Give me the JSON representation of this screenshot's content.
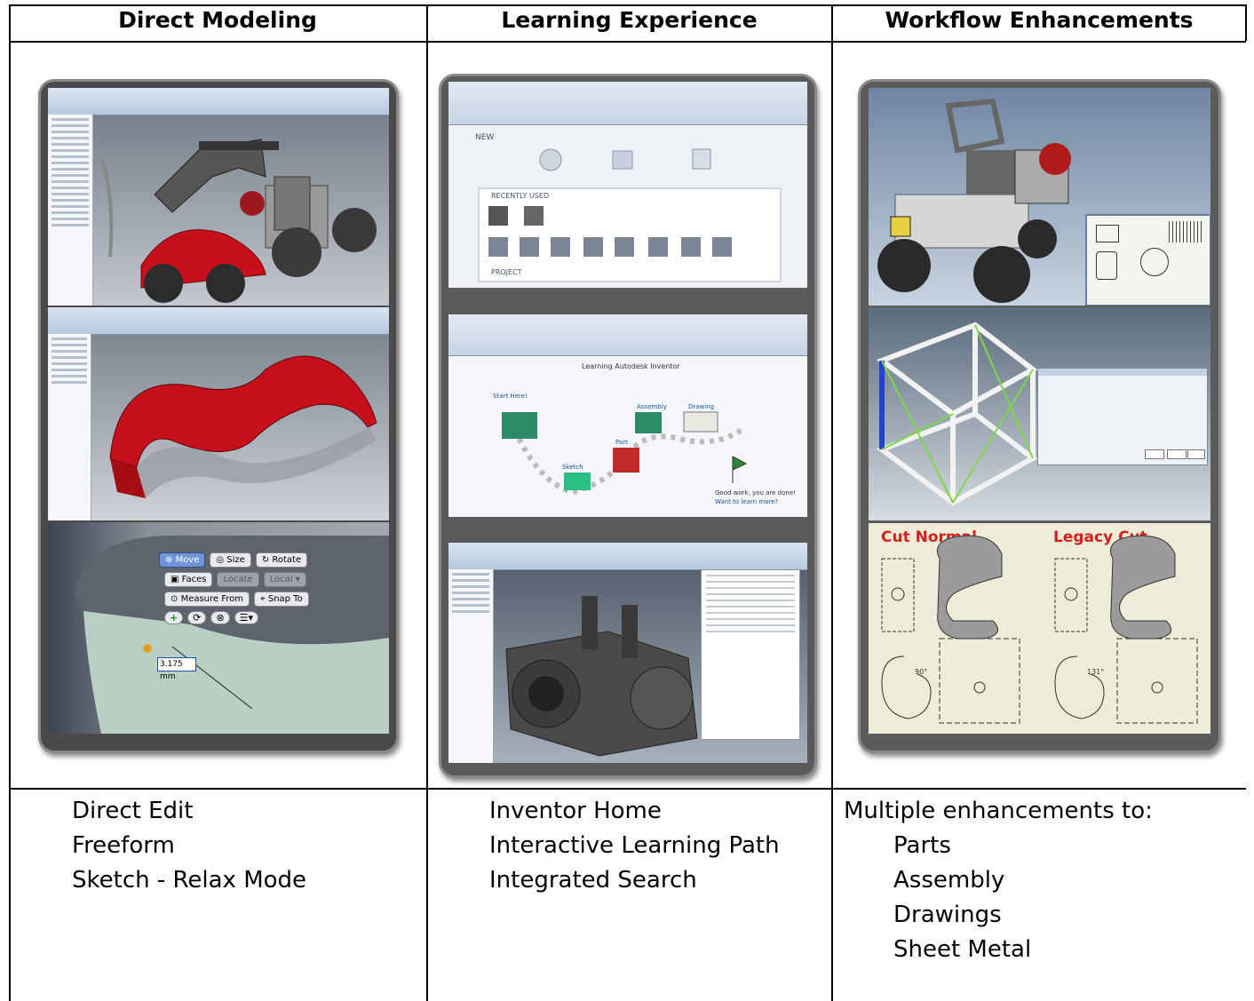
{
  "columns": [
    {
      "header": "Direct Modeling",
      "items": [
        "Direct Edit",
        "Freeform",
        "Sketch - Relax Mode"
      ]
    },
    {
      "header": "Learning Experience",
      "items": [
        "Inventor Home",
        "Interactive Learning Path",
        "Integrated Search"
      ]
    },
    {
      "header": "Workflow Enhancements",
      "intro": "Multiple enhancements to:",
      "items": [
        "Parts",
        "Assembly",
        "Drawings",
        "Sheet Metal"
      ]
    }
  ],
  "screens": {
    "direct_edit": {
      "labels": [
        "Move",
        "Size",
        "Rotate",
        "Faces",
        "Locate",
        "Local",
        "Measure From",
        "Snap To"
      ],
      "value": "3.175 mm"
    },
    "learning": {
      "title": "Learning Autodesk Inventor",
      "steps": [
        "Start Here!",
        "Sketch",
        "Part",
        "Assembly",
        "Drawing"
      ],
      "done": "Good work, you are done!",
      "link": "Want to learn more?"
    },
    "home": {
      "new_label": "NEW",
      "recent_label": "RECENTLY USED",
      "project_label": "PROJECT"
    },
    "cut": {
      "left": "Cut Normal",
      "right": "Legacy Cut",
      "angle_left": "90°",
      "angle_right": "131°"
    }
  },
  "colors": {
    "line": "#000000",
    "frame": "#4a4a4a",
    "fender_red": "#c8101a",
    "cut_label": "#d42020"
  }
}
